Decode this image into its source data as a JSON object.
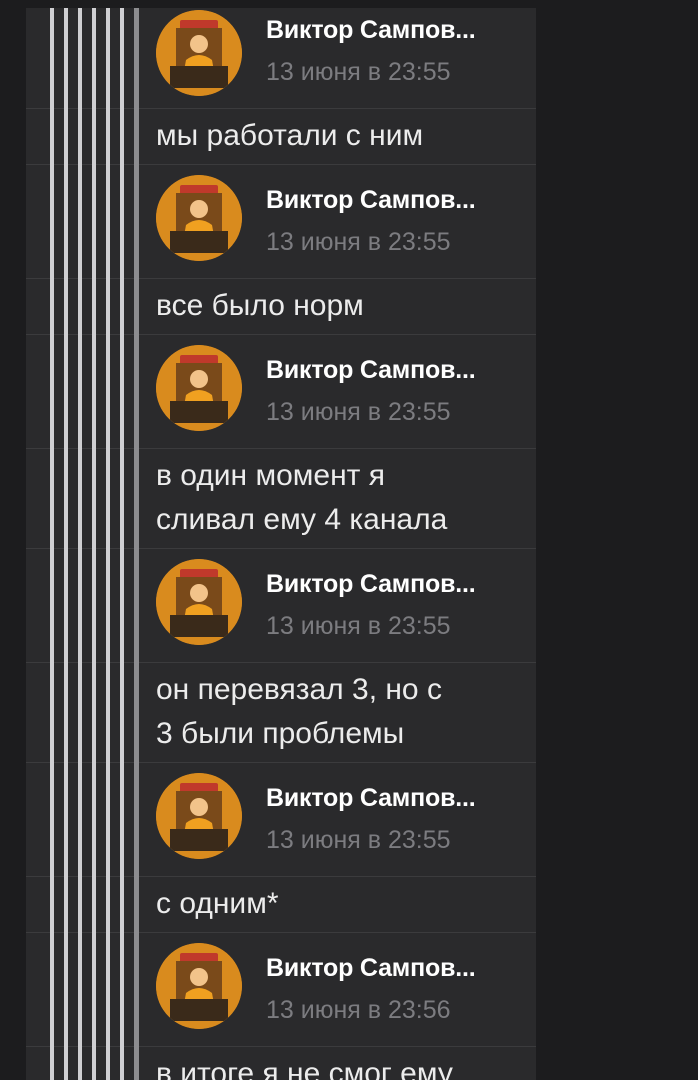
{
  "colors": {
    "background": "#1c1c1e",
    "panel": "#2a2a2c",
    "divider": "#3b3b3d",
    "author_text": "#ffffff",
    "time_text": "#7c7c80",
    "message_text": "#ececec",
    "thread_line": "#cfcfd2"
  },
  "avatar_icon": "user-avatar-icon",
  "messages": [
    {
      "author": "Виктор Сампов...",
      "time": "13 июня в 23:55",
      "text": "мы работали с ним"
    },
    {
      "author": "Виктор Сампов...",
      "time": "13 июня в 23:55",
      "text": "все было норм"
    },
    {
      "author": "Виктор Сампов...",
      "time": "13 июня в 23:55",
      "text_lines": [
        "в один момент я",
        "сливал ему 4 канала"
      ]
    },
    {
      "author": "Виктор Сампов...",
      "time": "13 июня в 23:55",
      "text_lines": [
        "он перевязал 3, но с",
        "3 были проблемы"
      ]
    },
    {
      "author": "Виктор Сампов...",
      "time": "13 июня в 23:55",
      "text": "с одним*"
    },
    {
      "author": "Виктор Сампов...",
      "time": "13 июня в 23:56",
      "text": "в итоге я не смог ему"
    }
  ]
}
